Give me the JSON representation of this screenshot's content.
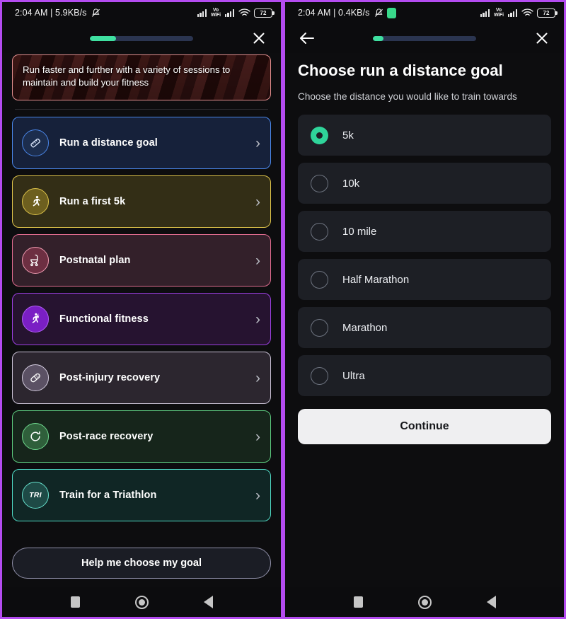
{
  "status_bar": {
    "time_and_rate_left": "2:04 AM | 5.9KB/s",
    "time_and_rate_right": "2:04 AM | 0.4KB/s",
    "silent_icon": "silent-bell-icon",
    "fingerprint_icon": "fingerprint-icon",
    "volte_line1": "Vo",
    "volte_line2": "WiFi",
    "battery_level": "72",
    "wifi_icon": "wifi-icon",
    "signal_icon": "cellular-signal-icon"
  },
  "left_panel": {
    "appbar": {
      "progress_percent": 25,
      "close_label": "×",
      "close_icon": "close-icon"
    },
    "hero": {
      "text": "Run faster and further with a variety of sessions to maintain and build your fitness",
      "border_color": "#e08d8d"
    },
    "goals": [
      {
        "label": "Run a distance goal",
        "icon": "ruler-icon",
        "glyph": "✎",
        "border_color": "#4a86e8",
        "bg_color": "#16213a",
        "icon_border": "#4a86e8",
        "icon_bg": "#1c2d4d",
        "icon_color": "#dce7fb"
      },
      {
        "label": "Run a first 5k",
        "icon": "runner-icon",
        "glyph": "🏃",
        "border_color": "#dfc44a",
        "bg_color": "#332e16",
        "icon_border": "#dfc44a",
        "icon_bg": "#6d5f1f",
        "icon_color": "#ffffff"
      },
      {
        "label": "Postnatal plan",
        "icon": "stroller-icon",
        "glyph": "⛺",
        "border_color": "#e06c8f",
        "bg_color": "#33202a",
        "icon_border": "#f29db3",
        "icon_bg": "#6d2f42",
        "icon_color": "#ffffff"
      },
      {
        "label": "Functional fitness",
        "icon": "lightning-person-icon",
        "glyph": "⚡",
        "border_color": "#9b3fe0",
        "bg_color": "#261330",
        "icon_border": "#b05ef5",
        "icon_bg": "#7a1fc4",
        "icon_color": "#ffffff"
      },
      {
        "label": "Post-injury recovery",
        "icon": "bandage-icon",
        "glyph": "⚕",
        "border_color": "#c8c0d4",
        "bg_color": "#2c262f",
        "icon_border": "#d5cde0",
        "icon_bg": "#5b5164",
        "icon_color": "#ffffff"
      },
      {
        "label": "Post-race recovery",
        "icon": "refresh-circle-icon",
        "glyph": "↻",
        "border_color": "#5cc87e",
        "bg_color": "#16251b",
        "icon_border": "#6fd98e",
        "icon_bg": "#2f5f3b",
        "icon_color": "#ffffff"
      },
      {
        "label": "Train for a Triathlon",
        "icon": "triathlon-icon",
        "glyph": "TRI",
        "border_color": "#4fd9c4",
        "bg_color": "#102625",
        "icon_border": "#66e0cc",
        "icon_bg": "#1e4a46",
        "icon_color": "#ffffff"
      }
    ],
    "help_button": "Help me choose my goal"
  },
  "right_panel": {
    "appbar": {
      "progress_percent": 10,
      "back_icon": "back-arrow-icon",
      "close_icon": "close-icon"
    },
    "title": "Choose run a distance goal",
    "subtitle": "Choose the distance you would like to train towards",
    "options": [
      {
        "label": "5k",
        "selected": true
      },
      {
        "label": "10k",
        "selected": false
      },
      {
        "label": "10 mile",
        "selected": false
      },
      {
        "label": "Half Marathon",
        "selected": false
      },
      {
        "label": "Marathon",
        "selected": false
      },
      {
        "label": "Ultra",
        "selected": false
      }
    ],
    "continue_button": "Continue",
    "accent_color": "#2fd49a"
  },
  "nav_bar": {
    "recent_icon": "square-recents-icon",
    "home_icon": "circle-home-icon",
    "back_icon": "triangle-back-icon"
  }
}
